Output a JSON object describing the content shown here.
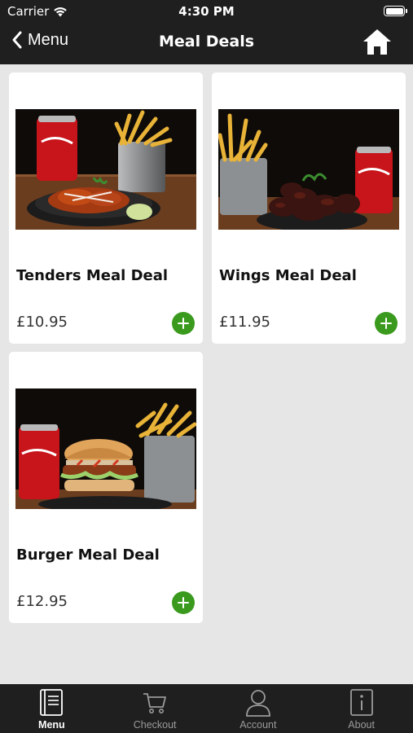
{
  "status_bar": {
    "carrier": "Carrier",
    "time": "4:30 PM"
  },
  "nav_bar": {
    "back_label": "Menu",
    "title": "Meal Deals"
  },
  "products": [
    {
      "name": "Tenders Meal Deal",
      "price": "£10.95"
    },
    {
      "name": "Wings Meal Deal",
      "price": "£11.95"
    },
    {
      "name": "Burger Meal Deal",
      "price": "£12.95"
    }
  ],
  "tab_bar": {
    "tabs": [
      {
        "label": "Menu",
        "icon": "menu-book-icon",
        "active": true
      },
      {
        "label": "Checkout",
        "icon": "cart-icon",
        "active": false
      },
      {
        "label": "Account",
        "icon": "person-icon",
        "active": false
      },
      {
        "label": "About",
        "icon": "info-icon",
        "active": false
      }
    ]
  },
  "colors": {
    "bar_background": "#1f1f1f",
    "add_button": "#3a9a1d",
    "page_background": "#e6e6e6"
  }
}
